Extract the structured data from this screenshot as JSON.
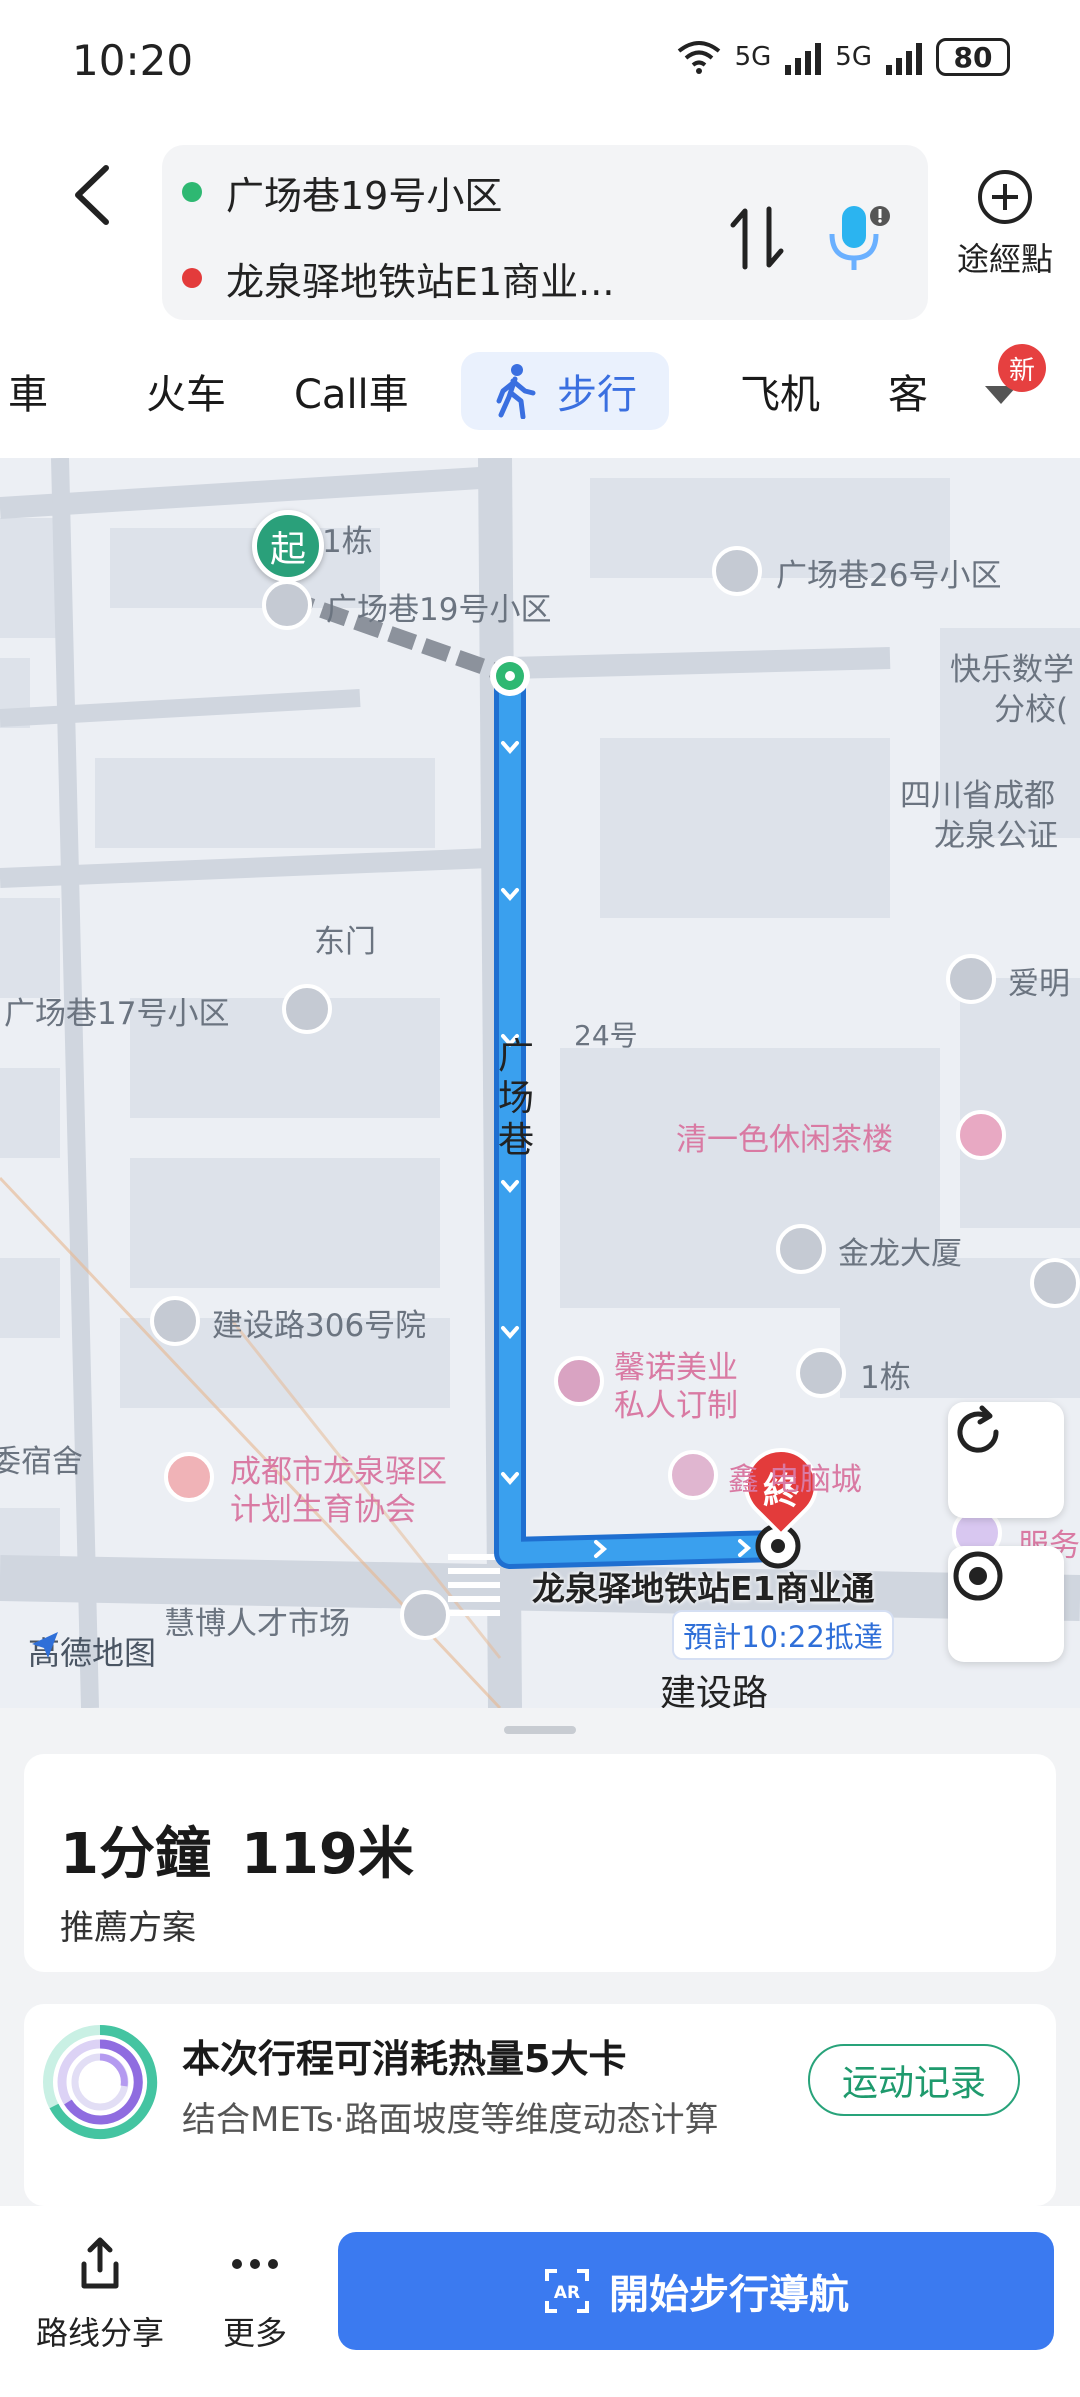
{
  "status_bar": {
    "time": "10:20",
    "battery": "80",
    "net1": "5G",
    "net2": "5G"
  },
  "route": {
    "origin": "广场巷19号小区",
    "destination": "龙泉驿地铁站E1商业...",
    "waypoint_label": "途經點",
    "origin_color": "#2eb872",
    "destination_color": "#e33b3b"
  },
  "tabs": [
    {
      "label": "車"
    },
    {
      "label": "火车"
    },
    {
      "label": "Call車"
    },
    {
      "label": "步行"
    },
    {
      "label": "飞机"
    },
    {
      "label": "客"
    }
  ],
  "new_badge": "新",
  "map": {
    "start_marker": "起",
    "end_marker": "終",
    "labels": {
      "building1": "1栋",
      "origin_poi": "广场巷19号小区",
      "poi26": "广场巷26号小区",
      "school1": "快乐数学",
      "school2": "分校(",
      "sichuan1": "四川省成都",
      "sichuan2": "龙泉公证",
      "east_gate": "东门",
      "poi17": "广场巷17号小区",
      "aiming": "爱明",
      "no24": "24号",
      "road_v": "广场巷",
      "tea": "清一色休闲茶楼",
      "jinlong": "金龙大厦",
      "jianshe306": "建设路306号院",
      "beauty1": "馨诺美业",
      "beauty2": "私人订制",
      "building1b": "1栋",
      "dorm": "委宿舍",
      "family1": "成都市龙泉驿区",
      "family2": "计划生育协会",
      "computer": "鑫  电脑城",
      "service": "服务",
      "destination": "龙泉驿地铁站E1商业通",
      "talent": "慧博人才市场",
      "road_h": "建设路",
      "logo": "高德地图"
    },
    "eta": "預計10:22抵達",
    "route_color": "#3aa0ee"
  },
  "summary": {
    "time": "1分鐘",
    "distance": "119米",
    "plan": "推薦方案"
  },
  "calorie": {
    "title": "本次行程可消耗热量5大卡",
    "subtitle": "结合METs·路面坡度等维度动态计算",
    "button": "运动记录"
  },
  "bottom_bar": {
    "share": "路线分享",
    "more": "更多",
    "start_nav": "開始步行導航"
  }
}
